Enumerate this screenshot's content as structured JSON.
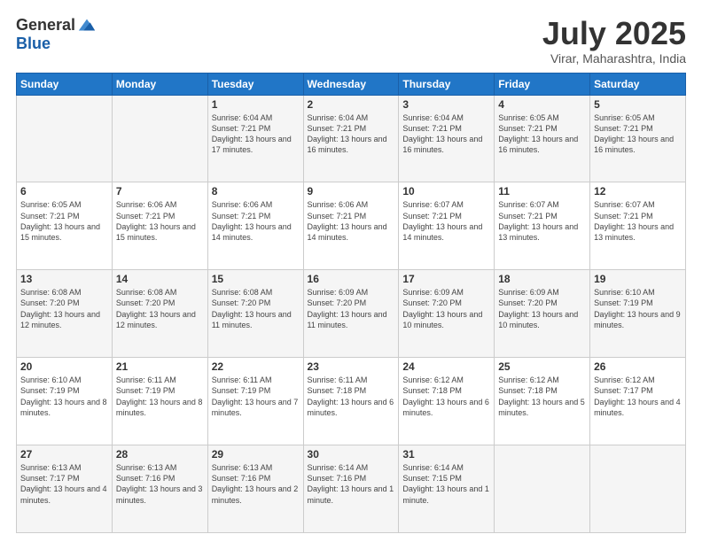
{
  "header": {
    "logo_general": "General",
    "logo_blue": "Blue",
    "month_year": "July 2025",
    "location": "Virar, Maharashtra, India"
  },
  "weekdays": [
    "Sunday",
    "Monday",
    "Tuesday",
    "Wednesday",
    "Thursday",
    "Friday",
    "Saturday"
  ],
  "weeks": [
    [
      {
        "day": "",
        "sunrise": "",
        "sunset": "",
        "daylight": ""
      },
      {
        "day": "",
        "sunrise": "",
        "sunset": "",
        "daylight": ""
      },
      {
        "day": "1",
        "sunrise": "Sunrise: 6:04 AM",
        "sunset": "Sunset: 7:21 PM",
        "daylight": "Daylight: 13 hours and 17 minutes."
      },
      {
        "day": "2",
        "sunrise": "Sunrise: 6:04 AM",
        "sunset": "Sunset: 7:21 PM",
        "daylight": "Daylight: 13 hours and 16 minutes."
      },
      {
        "day": "3",
        "sunrise": "Sunrise: 6:04 AM",
        "sunset": "Sunset: 7:21 PM",
        "daylight": "Daylight: 13 hours and 16 minutes."
      },
      {
        "day": "4",
        "sunrise": "Sunrise: 6:05 AM",
        "sunset": "Sunset: 7:21 PM",
        "daylight": "Daylight: 13 hours and 16 minutes."
      },
      {
        "day": "5",
        "sunrise": "Sunrise: 6:05 AM",
        "sunset": "Sunset: 7:21 PM",
        "daylight": "Daylight: 13 hours and 16 minutes."
      }
    ],
    [
      {
        "day": "6",
        "sunrise": "Sunrise: 6:05 AM",
        "sunset": "Sunset: 7:21 PM",
        "daylight": "Daylight: 13 hours and 15 minutes."
      },
      {
        "day": "7",
        "sunrise": "Sunrise: 6:06 AM",
        "sunset": "Sunset: 7:21 PM",
        "daylight": "Daylight: 13 hours and 15 minutes."
      },
      {
        "day": "8",
        "sunrise": "Sunrise: 6:06 AM",
        "sunset": "Sunset: 7:21 PM",
        "daylight": "Daylight: 13 hours and 14 minutes."
      },
      {
        "day": "9",
        "sunrise": "Sunrise: 6:06 AM",
        "sunset": "Sunset: 7:21 PM",
        "daylight": "Daylight: 13 hours and 14 minutes."
      },
      {
        "day": "10",
        "sunrise": "Sunrise: 6:07 AM",
        "sunset": "Sunset: 7:21 PM",
        "daylight": "Daylight: 13 hours and 14 minutes."
      },
      {
        "day": "11",
        "sunrise": "Sunrise: 6:07 AM",
        "sunset": "Sunset: 7:21 PM",
        "daylight": "Daylight: 13 hours and 13 minutes."
      },
      {
        "day": "12",
        "sunrise": "Sunrise: 6:07 AM",
        "sunset": "Sunset: 7:21 PM",
        "daylight": "Daylight: 13 hours and 13 minutes."
      }
    ],
    [
      {
        "day": "13",
        "sunrise": "Sunrise: 6:08 AM",
        "sunset": "Sunset: 7:20 PM",
        "daylight": "Daylight: 13 hours and 12 minutes."
      },
      {
        "day": "14",
        "sunrise": "Sunrise: 6:08 AM",
        "sunset": "Sunset: 7:20 PM",
        "daylight": "Daylight: 13 hours and 12 minutes."
      },
      {
        "day": "15",
        "sunrise": "Sunrise: 6:08 AM",
        "sunset": "Sunset: 7:20 PM",
        "daylight": "Daylight: 13 hours and 11 minutes."
      },
      {
        "day": "16",
        "sunrise": "Sunrise: 6:09 AM",
        "sunset": "Sunset: 7:20 PM",
        "daylight": "Daylight: 13 hours and 11 minutes."
      },
      {
        "day": "17",
        "sunrise": "Sunrise: 6:09 AM",
        "sunset": "Sunset: 7:20 PM",
        "daylight": "Daylight: 13 hours and 10 minutes."
      },
      {
        "day": "18",
        "sunrise": "Sunrise: 6:09 AM",
        "sunset": "Sunset: 7:20 PM",
        "daylight": "Daylight: 13 hours and 10 minutes."
      },
      {
        "day": "19",
        "sunrise": "Sunrise: 6:10 AM",
        "sunset": "Sunset: 7:19 PM",
        "daylight": "Daylight: 13 hours and 9 minutes."
      }
    ],
    [
      {
        "day": "20",
        "sunrise": "Sunrise: 6:10 AM",
        "sunset": "Sunset: 7:19 PM",
        "daylight": "Daylight: 13 hours and 8 minutes."
      },
      {
        "day": "21",
        "sunrise": "Sunrise: 6:11 AM",
        "sunset": "Sunset: 7:19 PM",
        "daylight": "Daylight: 13 hours and 8 minutes."
      },
      {
        "day": "22",
        "sunrise": "Sunrise: 6:11 AM",
        "sunset": "Sunset: 7:19 PM",
        "daylight": "Daylight: 13 hours and 7 minutes."
      },
      {
        "day": "23",
        "sunrise": "Sunrise: 6:11 AM",
        "sunset": "Sunset: 7:18 PM",
        "daylight": "Daylight: 13 hours and 6 minutes."
      },
      {
        "day": "24",
        "sunrise": "Sunrise: 6:12 AM",
        "sunset": "Sunset: 7:18 PM",
        "daylight": "Daylight: 13 hours and 6 minutes."
      },
      {
        "day": "25",
        "sunrise": "Sunrise: 6:12 AM",
        "sunset": "Sunset: 7:18 PM",
        "daylight": "Daylight: 13 hours and 5 minutes."
      },
      {
        "day": "26",
        "sunrise": "Sunrise: 6:12 AM",
        "sunset": "Sunset: 7:17 PM",
        "daylight": "Daylight: 13 hours and 4 minutes."
      }
    ],
    [
      {
        "day": "27",
        "sunrise": "Sunrise: 6:13 AM",
        "sunset": "Sunset: 7:17 PM",
        "daylight": "Daylight: 13 hours and 4 minutes."
      },
      {
        "day": "28",
        "sunrise": "Sunrise: 6:13 AM",
        "sunset": "Sunset: 7:16 PM",
        "daylight": "Daylight: 13 hours and 3 minutes."
      },
      {
        "day": "29",
        "sunrise": "Sunrise: 6:13 AM",
        "sunset": "Sunset: 7:16 PM",
        "daylight": "Daylight: 13 hours and 2 minutes."
      },
      {
        "day": "30",
        "sunrise": "Sunrise: 6:14 AM",
        "sunset": "Sunset: 7:16 PM",
        "daylight": "Daylight: 13 hours and 1 minute."
      },
      {
        "day": "31",
        "sunrise": "Sunrise: 6:14 AM",
        "sunset": "Sunset: 7:15 PM",
        "daylight": "Daylight: 13 hours and 1 minute."
      },
      {
        "day": "",
        "sunrise": "",
        "sunset": "",
        "daylight": ""
      },
      {
        "day": "",
        "sunrise": "",
        "sunset": "",
        "daylight": ""
      }
    ]
  ]
}
